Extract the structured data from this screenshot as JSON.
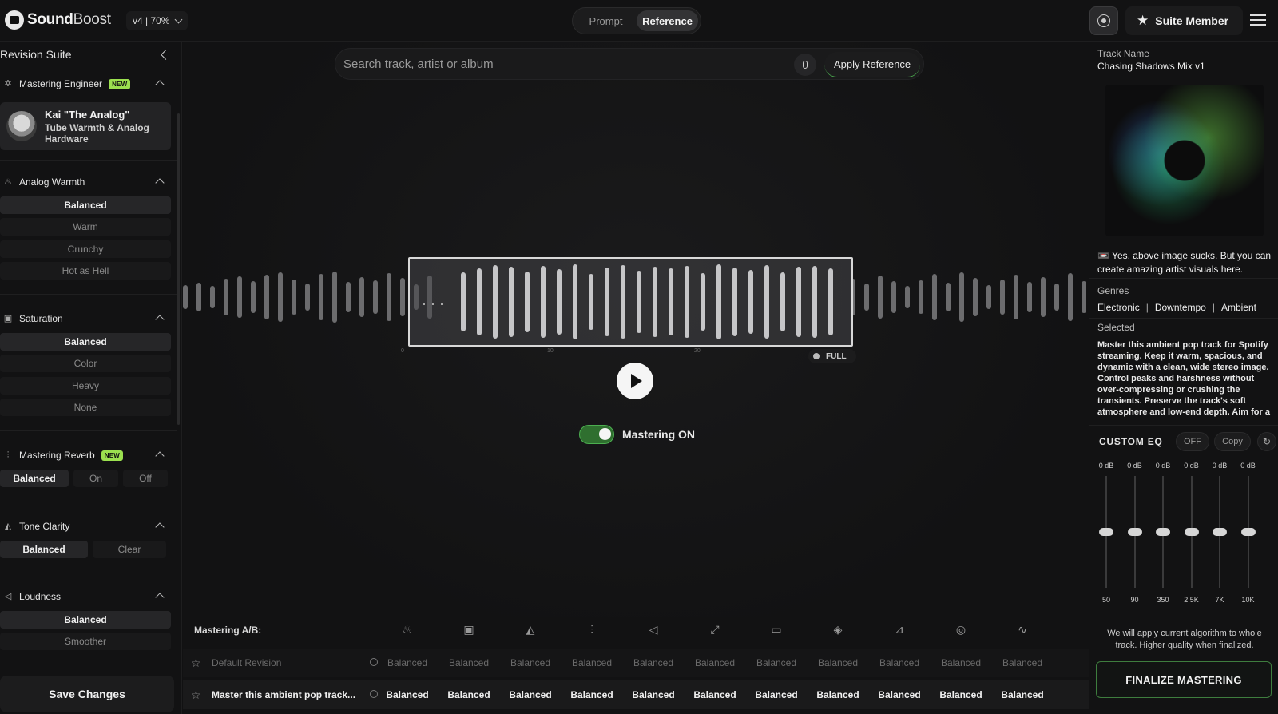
{
  "app": {
    "brand_bold": "Sound",
    "brand_light": "Boost",
    "version": "v4 | 70%"
  },
  "mode": {
    "tabs": [
      "Prompt",
      "Reference"
    ],
    "active": "Reference"
  },
  "header": {
    "member_label": "Suite Member"
  },
  "left": {
    "title": "Revision Suite",
    "engineer": {
      "section": "Mastering Engineer",
      "badge": "NEW",
      "name": "Kai \"The Analog\"",
      "desc": "Tube Warmth & Analog Hardware"
    },
    "analog_warmth": {
      "title": "Analog Warmth",
      "options": [
        "Balanced",
        "Warm",
        "Crunchy",
        "Hot as Hell"
      ],
      "selected": "Balanced"
    },
    "saturation": {
      "title": "Saturation",
      "options": [
        "Balanced",
        "Color",
        "Heavy",
        "None"
      ],
      "selected": "Balanced"
    },
    "reverb": {
      "title": "Mastering Reverb",
      "badge": "NEW",
      "options": [
        "Balanced",
        "On",
        "Off"
      ],
      "selected": "Balanced"
    },
    "tone_clarity": {
      "title": "Tone Clarity",
      "options": [
        "Balanced",
        "Clear"
      ],
      "selected": "Balanced"
    },
    "loudness": {
      "title": "Loudness",
      "options": [
        "Balanced",
        "Smoother"
      ],
      "selected": "Balanced"
    },
    "save_label": "Save Changes"
  },
  "center": {
    "search_placeholder": "Search track, artist or album",
    "apply_label": "Apply Reference",
    "full_label": "FULL",
    "mastering_label": "Mastering ON",
    "mastering_on": true
  },
  "ab": {
    "title": "Mastering A/B:",
    "icons": [
      "warmth-icon",
      "saturation-icon",
      "clarity-icon",
      "reverb-icon",
      "loudness-icon",
      "expand-icon",
      "stereo-icon",
      "balance-icon",
      "tilt-icon",
      "target-icon",
      "curve-icon"
    ],
    "rows": [
      {
        "name": "Default Revision",
        "values": [
          "Balanced",
          "Balanced",
          "Balanced",
          "Balanced",
          "Balanced",
          "Balanced",
          "Balanced",
          "Balanced",
          "Balanced",
          "Balanced",
          "Balanced"
        ]
      },
      {
        "name": "Master this ambient pop track...",
        "values": [
          "Balanced",
          "Balanced",
          "Balanced",
          "Balanced",
          "Balanced",
          "Balanced",
          "Balanced",
          "Balanced",
          "Balanced",
          "Balanced",
          "Balanced"
        ]
      }
    ]
  },
  "right": {
    "track_label": "Track Name",
    "track_name": "Chasing Shadows Mix v1",
    "art_note": "📼 Yes, above image sucks. But you can create amazing artist visuals here.",
    "genres_label": "Genres",
    "genres": [
      "Electronic",
      "Downtempo",
      "Ambient"
    ],
    "selected_label": "Selected",
    "selected_text": "Master this ambient pop track for Spotify streaming. Keep it warm, spacious, and dynamic with a clean, wide stereo image. Control peaks and harshness without over-compressing or crushing the transients. Preserve the track's soft atmosphere and low-end depth. Aim for a balanced",
    "eq": {
      "title": "CUSTOM EQ",
      "off_label": "OFF",
      "copy_label": "Copy",
      "bands": [
        {
          "db": "0 dB",
          "freq": "50"
        },
        {
          "db": "0 dB",
          "freq": "90"
        },
        {
          "db": "0 dB",
          "freq": "350"
        },
        {
          "db": "0 dB",
          "freq": "2.5K"
        },
        {
          "db": "0 dB",
          "freq": "7K"
        },
        {
          "db": "0 dB",
          "freq": "10K"
        }
      ]
    },
    "algo_note": "We will apply current algorithm to whole track. Higher quality when finalized.",
    "finalize_label": "FINALIZE MASTERING"
  }
}
